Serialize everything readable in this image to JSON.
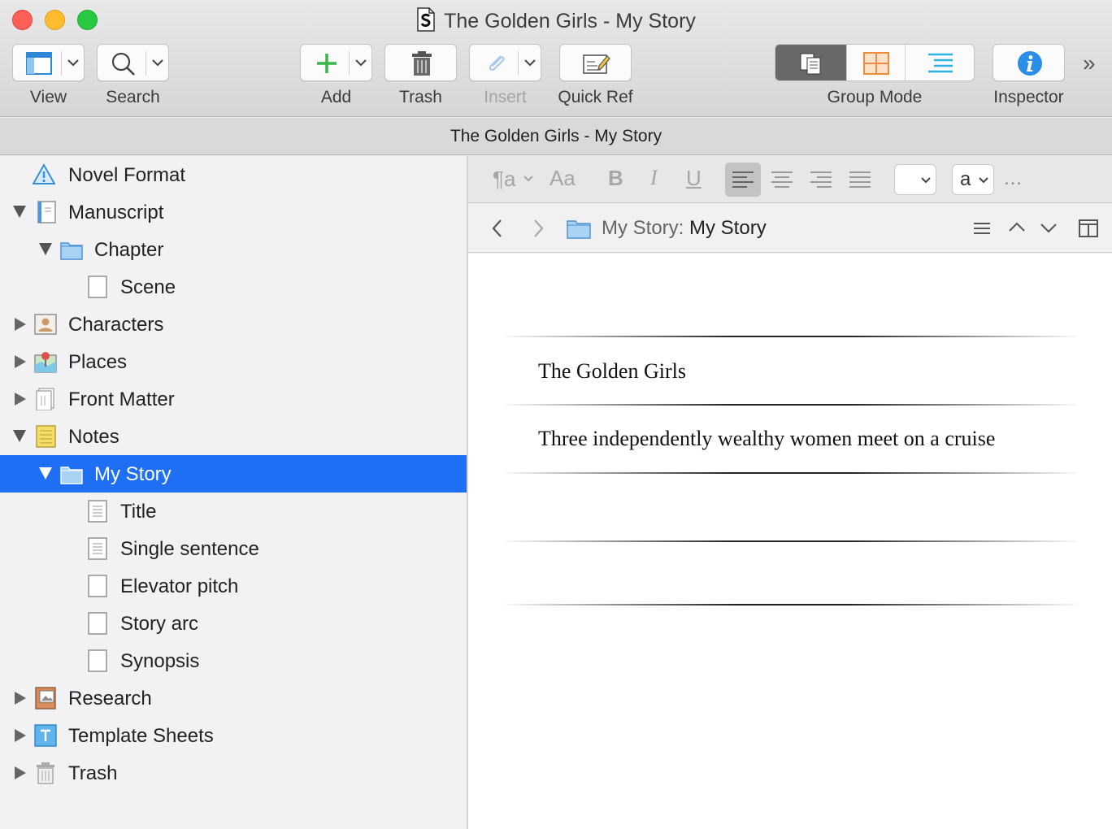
{
  "window": {
    "title": "The Golden Girls - My Story"
  },
  "toolbar": {
    "view_label": "View",
    "search_label": "Search",
    "add_label": "Add",
    "trash_label": "Trash",
    "insert_label": "Insert",
    "quickref_label": "Quick Ref",
    "groupmode_label": "Group Mode",
    "inspector_label": "Inspector",
    "more_glyph": "»"
  },
  "header": {
    "title": "The Golden Girls - My Story"
  },
  "binder": {
    "items": [
      {
        "label": "Novel Format",
        "icon": "novel-format-icon"
      },
      {
        "label": "Manuscript",
        "icon": "manuscript-icon"
      },
      {
        "label": "Chapter",
        "icon": "folder-icon"
      },
      {
        "label": "Scene",
        "icon": "blank-doc-icon"
      },
      {
        "label": "Characters",
        "icon": "characters-icon"
      },
      {
        "label": "Places",
        "icon": "places-icon"
      },
      {
        "label": "Front Matter",
        "icon": "front-matter-icon"
      },
      {
        "label": "Notes",
        "icon": "notes-icon"
      },
      {
        "label": "My Story",
        "icon": "folder-icon"
      },
      {
        "label": "Title",
        "icon": "text-doc-icon"
      },
      {
        "label": "Single sentence",
        "icon": "text-doc-icon"
      },
      {
        "label": "Elevator pitch",
        "icon": "blank-doc-icon"
      },
      {
        "label": "Story arc",
        "icon": "blank-doc-icon"
      },
      {
        "label": "Synopsis",
        "icon": "blank-doc-icon"
      },
      {
        "label": "Research",
        "icon": "research-icon"
      },
      {
        "label": "Template Sheets",
        "icon": "template-icon"
      },
      {
        "label": "Trash",
        "icon": "trash-icon"
      }
    ],
    "selected": "My Story"
  },
  "format_bar": {
    "paragraph_glyph": "¶a",
    "font_glyph": "Aa",
    "bold": "B",
    "italic": "I",
    "underline": "U",
    "style_popup_value": "a",
    "more_glyph": "…"
  },
  "navbar": {
    "crumb_prefix": "My Story:",
    "crumb_title": "My Story"
  },
  "document": {
    "lines": [
      "The Golden Girls",
      "Three independently wealthy women meet on a cruise",
      "",
      ""
    ]
  },
  "colors": {
    "selection": "#1f6ff5",
    "add_green": "#3ab54a",
    "inspector_blue": "#2b8fe8",
    "corkboard_orange": "#ee8d3e",
    "outline_cyan": "#2fb2e6"
  }
}
